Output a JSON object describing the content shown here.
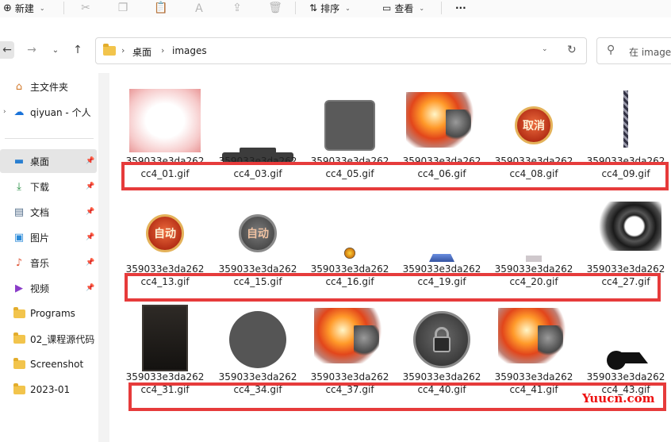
{
  "toolbar": {
    "new_label": "新建",
    "sort_label": "排序",
    "view_label": "查看",
    "more_label": "···"
  },
  "address": {
    "segments": [
      "桌面",
      "images"
    ]
  },
  "search": {
    "placeholder": "在 image"
  },
  "sidebar": {
    "items": [
      {
        "label": "主文件夹",
        "icon": "home-icon"
      },
      {
        "label": "qiyuan - 个人",
        "icon": "onedrive-icon"
      },
      {
        "label": "桌面",
        "icon": "desktop-icon",
        "active": true
      },
      {
        "label": "下载",
        "icon": "download-icon"
      },
      {
        "label": "文档",
        "icon": "document-icon"
      },
      {
        "label": "图片",
        "icon": "pictures-icon"
      },
      {
        "label": "音乐",
        "icon": "music-icon"
      },
      {
        "label": "视频",
        "icon": "video-icon"
      },
      {
        "label": "Programs",
        "icon": "folder-icon"
      },
      {
        "label": "02_课程源代码",
        "icon": "folder-icon"
      },
      {
        "label": "Screenshot",
        "icon": "folder-icon"
      },
      {
        "label": "2023-01",
        "icon": "folder-icon"
      }
    ]
  },
  "files": {
    "prefix": "359033e3da262",
    "row1": [
      "cc4_01.gif",
      "cc4_03.gif",
      "cc4_05.gif",
      "cc4_06.gif",
      "cc4_08.gif",
      "cc4_09.gif"
    ],
    "row2": [
      "cc4_13.gif",
      "cc4_15.gif",
      "cc4_16.gif",
      "cc4_19.gif",
      "cc4_20.gif",
      "cc4_27.gif"
    ],
    "row3": [
      "cc4_31.gif",
      "cc4_34.gif",
      "cc4_37.gif",
      "cc4_40.gif",
      "cc4_41.gif",
      "cc4_43.gif"
    ]
  },
  "thumb_text": {
    "cancel": "取消",
    "auto": "自动"
  },
  "watermark": "Yuucn.com",
  "colors": {
    "highlight": "#e63b3b",
    "folder": "#f2c44c"
  }
}
